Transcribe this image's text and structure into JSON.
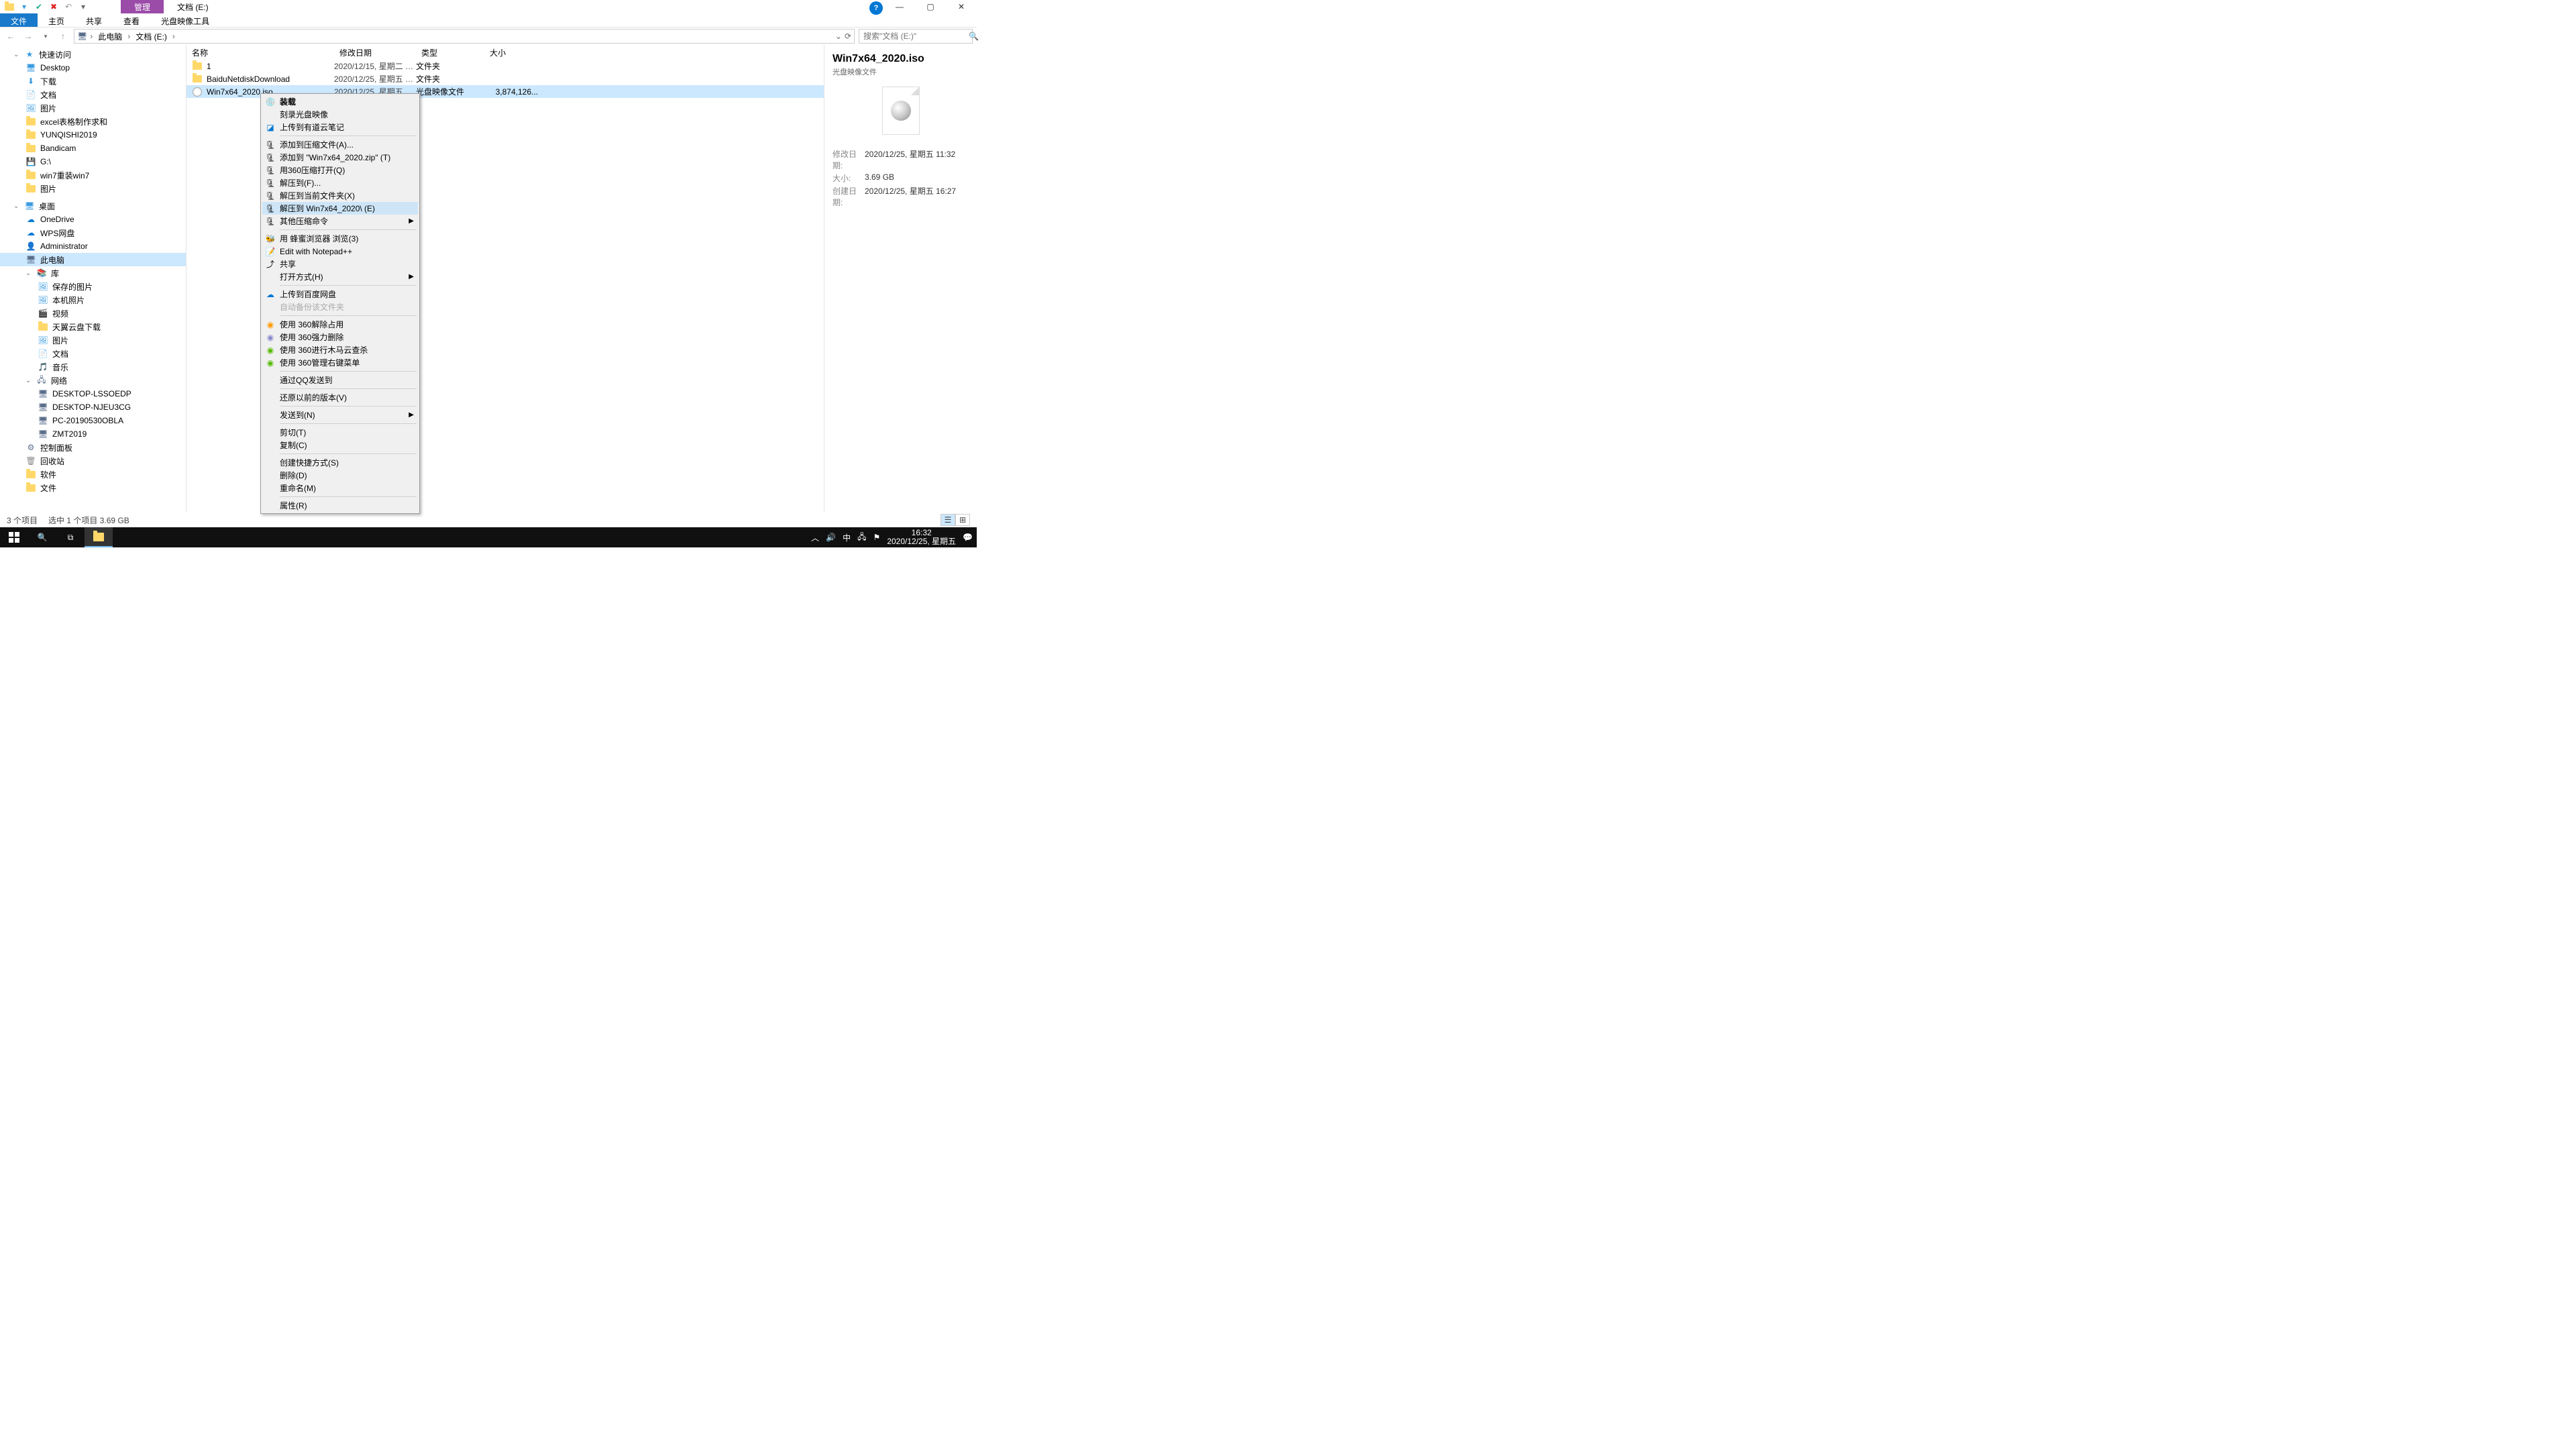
{
  "window": {
    "ctx_tab": "管理",
    "location_title": "文档 (E:)"
  },
  "ribbon": {
    "file": "文件",
    "home": "主页",
    "share": "共享",
    "view": "查看",
    "disc": "光盘映像工具"
  },
  "breadcrumb": {
    "seg1": "此电脑",
    "seg2": "文档 (E:)"
  },
  "search": {
    "placeholder": "搜索\"文档 (E:)\""
  },
  "nav": {
    "quick_access": "快速访问",
    "desktop": "Desktop",
    "downloads": "下载",
    "documents": "文档",
    "pictures_quick": "图片",
    "excel": "excel表格制作求和",
    "yunqishi": "YUNQISHI2019",
    "bandicam": "Bandicam",
    "gdrive": "G:\\",
    "win7": "win7重装win7",
    "pictures2": "图片",
    "desktop_root": "桌面",
    "onedrive": "OneDrive",
    "wps": "WPS网盘",
    "admin": "Administrator",
    "thispc": "此电脑",
    "libraries": "库",
    "saved_pics": "保存的图片",
    "local_photos": "本机照片",
    "videos": "视频",
    "tianyi": "天翼云盘下载",
    "pictures3": "图片",
    "docs": "文档",
    "music": "音乐",
    "network": "网络",
    "desktop_lss": "DESKTOP-LSSOEDP",
    "desktop_nj": "DESKTOP-NJEU3CG",
    "pc2019": "PC-20190530OBLA",
    "zmt": "ZMT2019",
    "control": "控制面板",
    "recycle": "回收站",
    "software": "软件",
    "files": "文件"
  },
  "columns": {
    "name": "名称",
    "date": "修改日期",
    "type": "类型",
    "size": "大小"
  },
  "rows": [
    {
      "name": "1",
      "date": "2020/12/15, 星期二 1...",
      "type": "文件夹",
      "size": ""
    },
    {
      "name": "BaiduNetdiskDownload",
      "date": "2020/12/25, 星期五 1...",
      "type": "文件夹",
      "size": ""
    },
    {
      "name": "Win7x64_2020.iso",
      "date": "2020/12/25, 星期五 1...",
      "type": "光盘映像文件",
      "size": "3,874,126..."
    }
  ],
  "ctx": {
    "mount": "装载",
    "burn": "刻录光盘映像",
    "youdao": "上传到有道云笔记",
    "add_archive": "添加到压缩文件(A)...",
    "add_zip": "添加到 \"Win7x64_2020.zip\" (T)",
    "open360": "用360压缩打开(Q)",
    "extract_to": "解压到(F)...",
    "extract_here": "解压到当前文件夹(X)",
    "extract_named": "解压到 Win7x64_2020\\ (E)",
    "other_compress": "其他压缩命令",
    "bee": "用 蜂蜜浏览器 浏览(3)",
    "notepad": "Edit with Notepad++",
    "share": "共享",
    "open_with": "打开方式(H)",
    "upload_baidu": "上传到百度网盘",
    "auto_backup": "自动备份该文件夹",
    "unlock360": "使用 360解除占用",
    "force_delete360": "使用 360强力删除",
    "trojan360": "使用 360进行木马云查杀",
    "manage360": "使用 360管理右键菜单",
    "qq_send": "通过QQ发送到",
    "restore": "还原以前的版本(V)",
    "send_to": "发送到(N)",
    "cut": "剪切(T)",
    "copy": "复制(C)",
    "shortcut": "创建快捷方式(S)",
    "delete": "删除(D)",
    "rename": "重命名(M)",
    "props": "属性(R)"
  },
  "preview": {
    "title": "Win7x64_2020.iso",
    "subtitle": "光盘映像文件",
    "mod_k": "修改日期:",
    "mod_v": "2020/12/25, 星期五 11:32",
    "size_k": "大小:",
    "size_v": "3.69 GB",
    "create_k": "创建日期:",
    "create_v": "2020/12/25, 星期五 16:27"
  },
  "status": {
    "count": "3 个项目",
    "sel": "选中 1 个项目  3.69 GB"
  },
  "tray": {
    "ime": "中",
    "time": "16:32",
    "date": "2020/12/25, 星期五"
  }
}
